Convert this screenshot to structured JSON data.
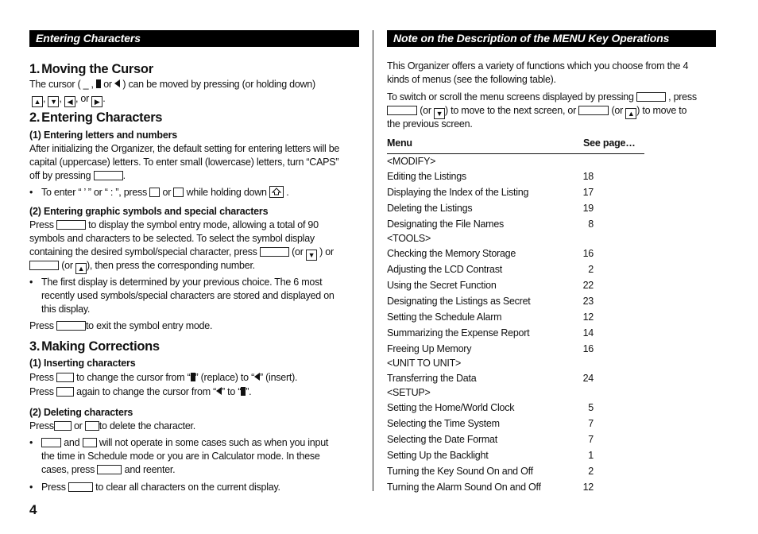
{
  "left": {
    "banner": "Entering Characters",
    "s1": {
      "num": "1.",
      "title": "Moving the Cursor",
      "line1a": "The cursor ( _ ,",
      "line1b": "or",
      "line1c": ") can be moved by pressing (or holding down)",
      "line2_sep1": ",",
      "line2_sep2": ",",
      "line2_sep3": ", or",
      "line2_end": "."
    },
    "s2": {
      "num": "2.",
      "title": "Entering Characters",
      "sub1": "(1)  Entering letters and numbers",
      "p1": [
        "After initializing the Organizer, the default setting for entering letters will be",
        "capital (uppercase) letters. To enter small (lowercase) letters, turn “CAPS”",
        "off by pressing"
      ],
      "p1_end": ".",
      "bullet1a": "To enter “ ’ ” or “ : ”, press",
      "bullet1b": "or",
      "bullet1c": "while holding down",
      "bullet1d": ".",
      "sub2": "(2)  Entering graphic symbols and special characters",
      "p2_l1a": "Press",
      "p2_l1b": "to display the symbol entry mode, allowing a total of 90",
      "p2_l2": "symbols and characters to be selected. To select the symbol display",
      "p2_l3a": "containing the desired symbol/special character, press",
      "p2_l3b": "(or",
      "p2_l3c": ") or",
      "p2_l4a": "(or",
      "p2_l4b": "), then press the corresponding number.",
      "bullet2": [
        "The first display is determined by your previous choice. The 6 most",
        "recently used symbols/special characters are stored and displayed on",
        "this display."
      ],
      "p3a": "Press",
      "p3b": "to exit the symbol entry mode."
    },
    "s3": {
      "num": "3.",
      "title": "Making Corrections",
      "sub1": "(1)  Inserting characters",
      "l1a": "Press",
      "l1b": "to change the cursor from “",
      "l1c": "” (replace) to “",
      "l1d": "” (insert).",
      "l2a": "Press",
      "l2b": "again to change the cursor from “",
      "l2c": "” to “",
      "l2d": "”.",
      "sub2": "(2)  Deleting characters",
      "d1a": "Press",
      "d1b": "or",
      "d1c": "to delete the character.",
      "b1a": "and",
      "b1b": "will not operate in some cases such as when you input",
      "b1_l2": "the time in Schedule mode or you are in Calculator mode. In these",
      "b1_l3a": "cases, press",
      "b1_l3b": "and reenter.",
      "b2a": "Press",
      "b2b": "to clear all characters on the current display."
    }
  },
  "right": {
    "banner": "Note on the Description of the MENU Key Operations",
    "p1": [
      "This Organizer offers a variety of functions which you choose from the 4",
      "kinds of menus (see the following table)."
    ],
    "p2_l1a": "To switch or scroll the menu screens displayed by pressing",
    "p2_l1b": ", press",
    "p2_l2a": "(or",
    "p2_l2b": ") to move to the next screen, or",
    "p2_l2c": "(or",
    "p2_l2d": ") to move to",
    "p2_l3": "the previous screen.",
    "table": {
      "headers": [
        "Menu",
        "See page…"
      ],
      "rows": [
        {
          "menu": "<MODIFY>",
          "page": ""
        },
        {
          "menu": "Editing the Listings",
          "page": "18"
        },
        {
          "menu": "Displaying the Index of the Listing",
          "page": "17"
        },
        {
          "menu": "Deleting the Listings",
          "page": "19"
        },
        {
          "menu": "Designating the File Names",
          "page": "8"
        },
        {
          "menu": "<TOOLS>",
          "page": ""
        },
        {
          "menu": "Checking the Memory Storage",
          "page": "16"
        },
        {
          "menu": "Adjusting the LCD Contrast",
          "page": "2"
        },
        {
          "menu": "Using the Secret Function",
          "page": "22"
        },
        {
          "menu": "Designating the Listings as Secret",
          "page": "23"
        },
        {
          "menu": "Setting the Schedule Alarm",
          "page": "12"
        },
        {
          "menu": "Summarizing the Expense Report",
          "page": "14"
        },
        {
          "menu": "Freeing Up Memory",
          "page": "16"
        },
        {
          "menu": "<UNIT TO UNIT>",
          "page": ""
        },
        {
          "menu": "Transferring the Data",
          "page": "24"
        },
        {
          "menu": "<SETUP>",
          "page": ""
        },
        {
          "menu": "Setting the Home/World Clock",
          "page": "5"
        },
        {
          "menu": "Selecting the Time System",
          "page": "7"
        },
        {
          "menu": "Selecting the Date Format",
          "page": "7"
        },
        {
          "menu": "Setting Up the Backlight",
          "page": "1"
        },
        {
          "menu": "Turning the Key Sound On and Off",
          "page": "2"
        },
        {
          "menu": "Turning the Alarm Sound On and Off",
          "page": "12"
        }
      ]
    }
  },
  "icons": {
    "up": "▲",
    "down": "▼",
    "left": "◀",
    "right": "▶"
  },
  "page_number": "4"
}
